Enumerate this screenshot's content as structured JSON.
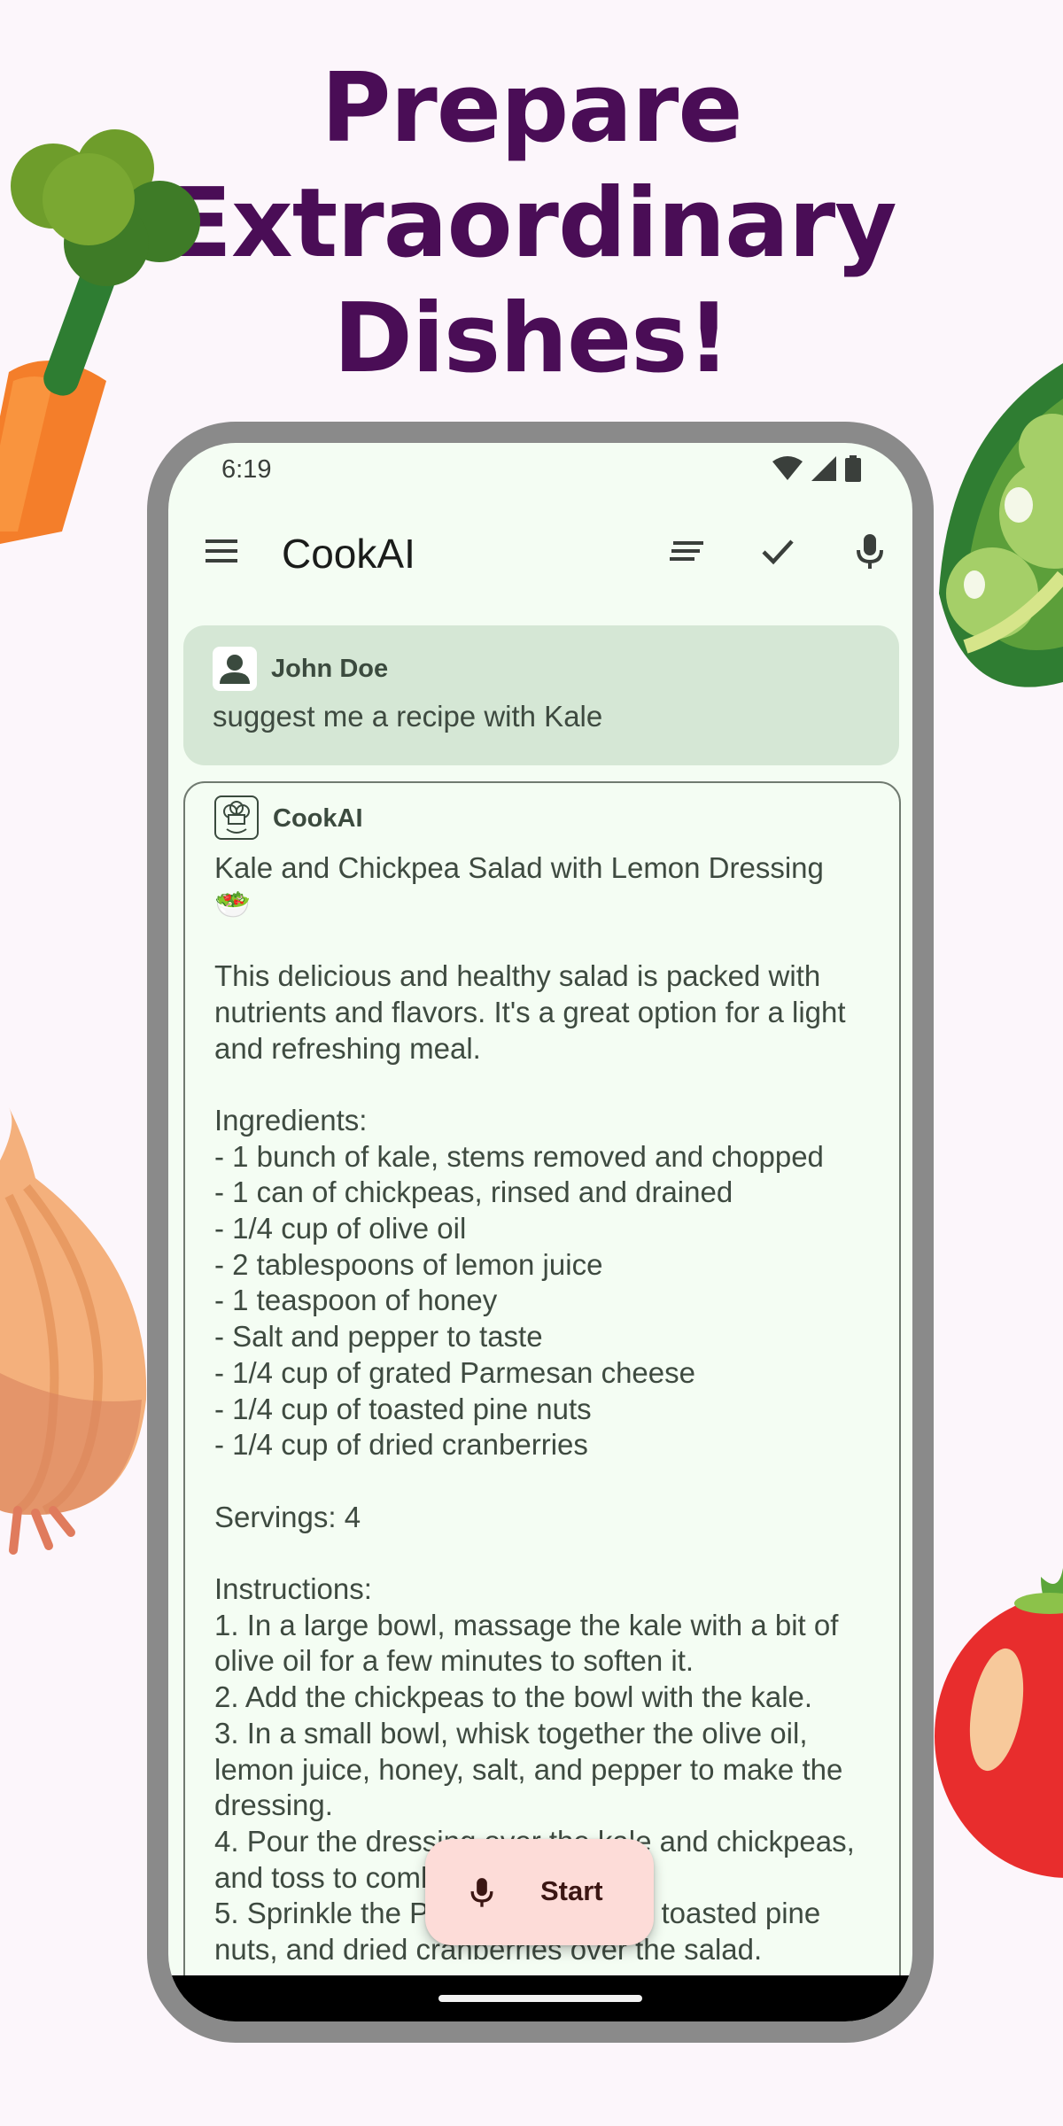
{
  "headline": {
    "line1": "Prepare",
    "line2": "Extraordinary",
    "line3": "Dishes!"
  },
  "decorations": [
    "carrot",
    "peas",
    "onion",
    "tomato"
  ],
  "status_bar": {
    "time": "6:19",
    "icons": [
      "wifi-icon",
      "signal-icon",
      "battery-icon"
    ]
  },
  "app_bar": {
    "title": "CookAI",
    "icons": [
      "menu-icon",
      "lines-icon",
      "check-icon",
      "microphone-icon"
    ]
  },
  "messages": [
    {
      "sender": "John Doe",
      "avatar_icon": "person-icon",
      "text": "suggest me a recipe with Kale"
    },
    {
      "sender": "CookAI",
      "avatar_icon": "chef-hat-icon",
      "text": "Kale and Chickpea Salad with Lemon Dressing\n🥗\n\nThis delicious and healthy salad is packed with nutrients and flavors. It's a great option for a light and refreshing meal.\n\nIngredients:\n- 1 bunch of kale, stems removed and chopped\n- 1 can of chickpeas, rinsed and drained\n- 1/4 cup of olive oil\n- 2 tablespoons of lemon juice\n- 1 teaspoon of honey\n- Salt and pepper to taste\n- 1/4 cup of grated Parmesan cheese\n- 1/4 cup of toasted pine nuts\n- 1/4 cup of dried cranberries\n\nServings: 4\n\nInstructions:\n1. In a large bowl, massage the kale with a bit of olive oil for a few minutes to soften it.\n2. Add the chickpeas to the bowl with the kale.\n3. In a small bowl, whisk together the olive oil, lemon juice, honey, salt, and pepper to make the dressing.\n4. Pour the dressing over the kale and chickpeas, and toss to combine.\n5. Sprinkle the Parmesan cheese, toasted pine nuts, and dried cranberries over the salad."
    }
  ],
  "fab": {
    "label": "Start",
    "icon": "microphone-icon"
  },
  "colors": {
    "headline": "#4a0d56",
    "screen_background": "#f4fdf3",
    "user_bubble": "#d5e7d5",
    "fab_background": "#fddcd8"
  }
}
